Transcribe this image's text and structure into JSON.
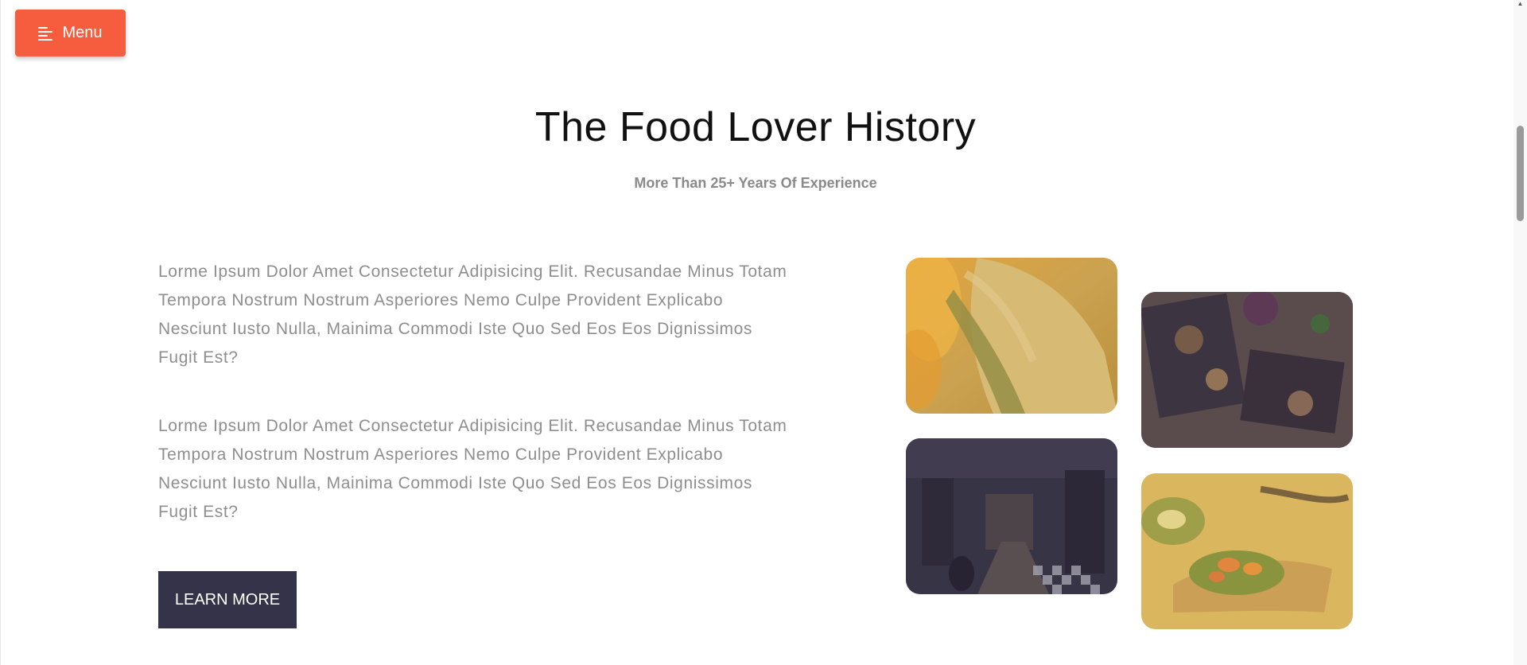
{
  "menu": {
    "label": "Menu",
    "icon": "menu-icon"
  },
  "section": {
    "title": "The Food Lover History",
    "subtitle": "More Than 25+ Years Of Experience",
    "paragraphs": [
      "Lorme Ipsum Dolor Amet Consectetur Adipisicing Elit. Recusandae Minus Totam Tempora Nostrum Nostrum Asperiores Nemo Culpe Provident Explicabo Nesciunt Iusto Nulla, Mainima Commodi Iste Quo Sed Eos Eos Dignissimos Fugit Est?",
      "Lorme Ipsum Dolor Amet Consectetur Adipisicing Elit. Recusandae Minus Totam Tempora Nostrum Nostrum Asperiores Nemo Culpe Provident Explicabo Nesciunt Iusto Nulla, Mainima Commodi Iste Quo Sed Eos Eos Dignissimos Fugit Est?"
    ],
    "cta_label": "LEARN MORE"
  },
  "colors": {
    "accent": "#f55d3e",
    "button_dark": "#35334a",
    "text_muted": "#8e8e8e"
  }
}
